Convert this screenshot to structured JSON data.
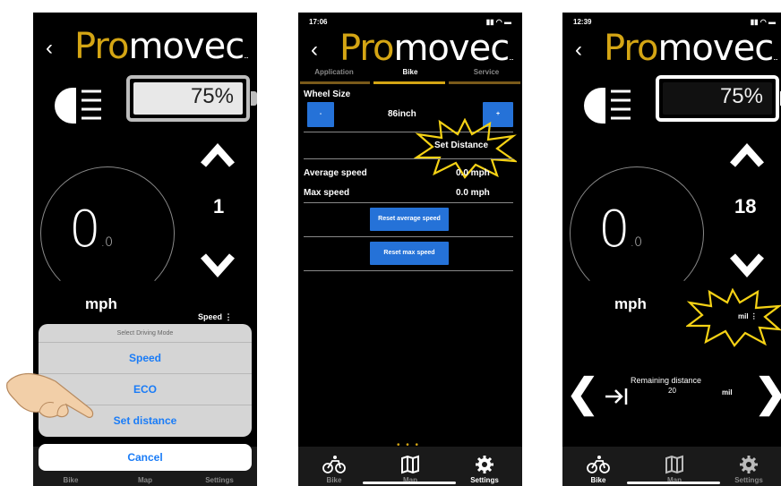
{
  "colors": {
    "brand_gold": "#d4a514",
    "ios_blue": "#1a7cf7",
    "button_blue": "#2572d8",
    "burst_yellow": "#f5d215"
  },
  "logo": {
    "prefix": "Pro",
    "suffix": "movec",
    "tm": "..."
  },
  "back_glyph": "‹",
  "screen1": {
    "battery": "75%",
    "gear": "1",
    "speed": "0",
    "speed_decimal": ".0",
    "unit": "mph",
    "mode_indicator": "Speed ⋮",
    "sheet": {
      "title": "Select Driving Mode",
      "options": [
        "Speed",
        "ECO",
        "Set distance"
      ],
      "cancel": "Cancel"
    },
    "tabs": {
      "bike": "Bike",
      "map": "Map",
      "settings": "Settings"
    }
  },
  "screen2": {
    "status_time": "17:06",
    "tabs": [
      "Application",
      "Bike",
      "Service"
    ],
    "active_tab": "Bike",
    "wheel_size_label": "Wheel Size",
    "minus": "-",
    "wheel_size_value": "86inch",
    "plus": "+",
    "set_distance": "Set Distance",
    "average_speed_label": "Average speed",
    "average_speed_value": "0.0 mph",
    "max_speed_label": "Max speed",
    "max_speed_value": "0.0 mph",
    "reset_average": "Reset average speed",
    "reset_max": "Reset max speed",
    "pager": "• • •",
    "bottom_tabs": {
      "bike": "Bike",
      "map": "Map",
      "settings": "Settings"
    }
  },
  "screen3": {
    "status_time": "12:39",
    "battery": "75%",
    "gear": "18",
    "speed": "0",
    "speed_decimal": ".0",
    "unit": "mph",
    "mode_indicator": "mil ⋮",
    "remaining_label": "Remaining distance",
    "remaining_value": "20",
    "remaining_unit": "mil",
    "bottom_tabs": {
      "bike": "Bike",
      "map": "Map",
      "settings": "Settings"
    }
  }
}
